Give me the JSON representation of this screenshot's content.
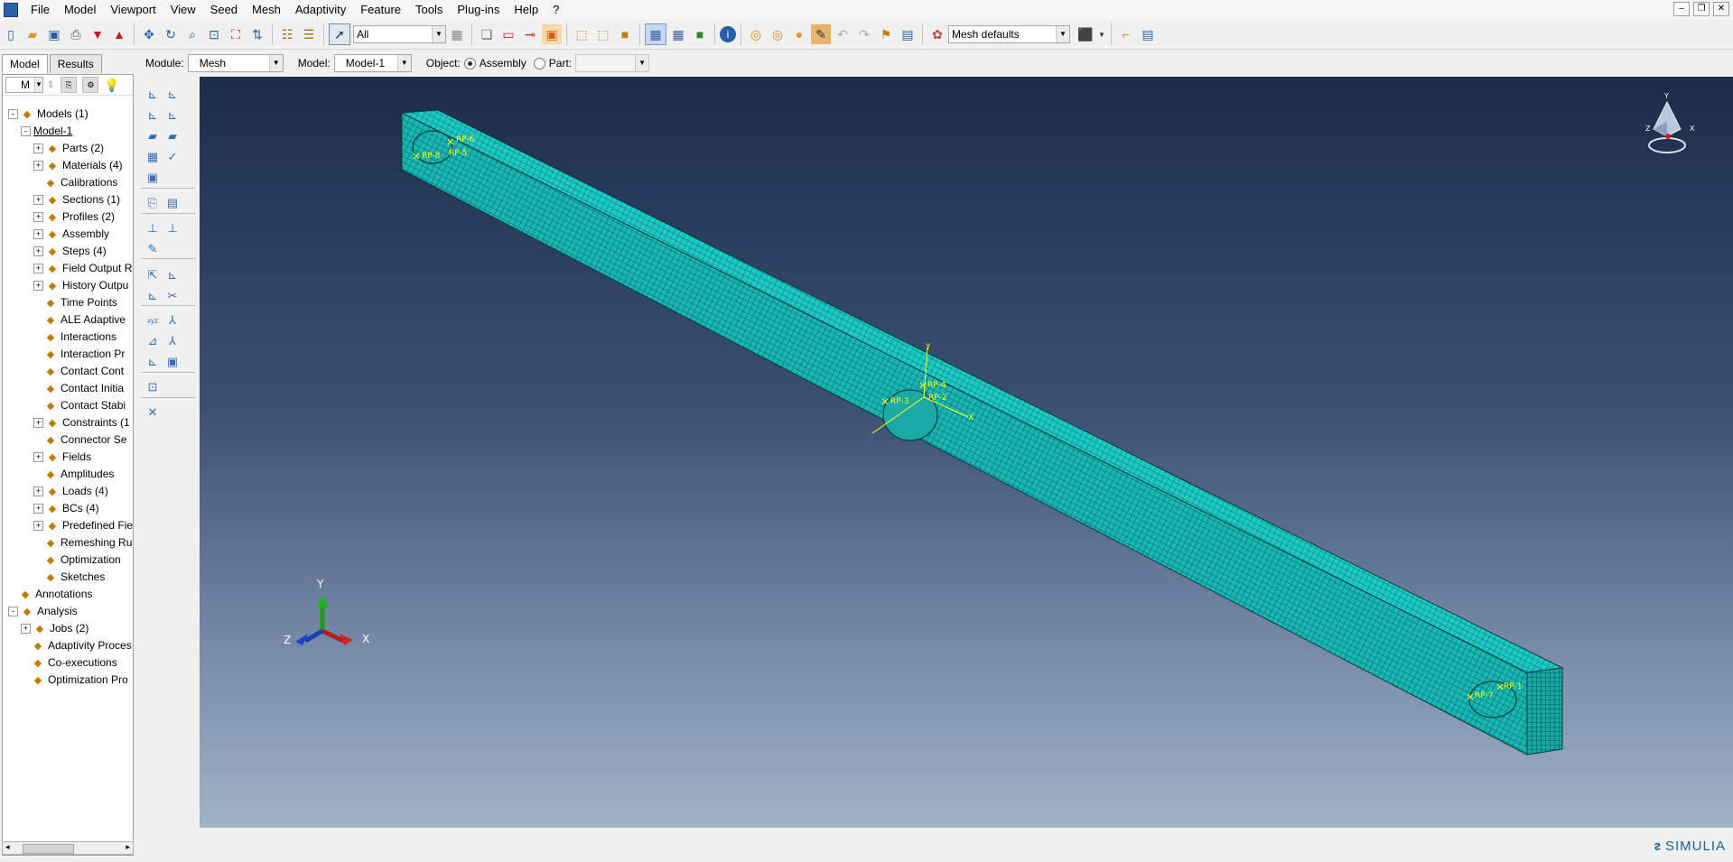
{
  "menu": [
    "File",
    "Model",
    "Viewport",
    "View",
    "Seed",
    "Mesh",
    "Adaptivity",
    "Feature",
    "Tools",
    "Plug-ins",
    "Help",
    "?"
  ],
  "toolbar": {
    "selection_filter": "All",
    "display_group_value": "Mesh defaults"
  },
  "context": {
    "module_label": "Module:",
    "module_value": "Mesh",
    "model_label": "Model:",
    "model_value": "Model-1",
    "object_label": "Object:",
    "assembly_label": "Assembly",
    "part_label": "Part:",
    "part_value": "",
    "object_selected": "Assembly"
  },
  "tabs": [
    "Model",
    "Results"
  ],
  "tree_tools_selector": "M",
  "tree": [
    {
      "label": "Models (1)",
      "level": 0,
      "exp": "-",
      "icon": "models-icon"
    },
    {
      "label": "Model-1",
      "level": 1,
      "exp": "-",
      "icon": ""
    },
    {
      "label": "Parts (2)",
      "level": 2,
      "exp": "+",
      "icon": "parts-icon"
    },
    {
      "label": "Materials (4)",
      "level": 2,
      "exp": "+",
      "icon": "materials-icon"
    },
    {
      "label": "Calibrations",
      "level": 2,
      "exp": "",
      "icon": "calibrations-icon"
    },
    {
      "label": "Sections (1)",
      "level": 2,
      "exp": "+",
      "icon": "sections-icon"
    },
    {
      "label": "Profiles (2)",
      "level": 2,
      "exp": "+",
      "icon": "profiles-icon"
    },
    {
      "label": "Assembly",
      "level": 2,
      "exp": "+",
      "icon": "assembly-icon"
    },
    {
      "label": "Steps (4)",
      "level": 2,
      "exp": "+",
      "icon": "steps-icon"
    },
    {
      "label": "Field Output R",
      "level": 2,
      "exp": "+",
      "icon": "field-output-icon"
    },
    {
      "label": "History Outpu",
      "level": 2,
      "exp": "+",
      "icon": "history-output-icon"
    },
    {
      "label": "Time Points",
      "level": 2,
      "exp": "",
      "icon": "time-points-icon"
    },
    {
      "label": "ALE Adaptive",
      "level": 2,
      "exp": "",
      "icon": "ale-icon"
    },
    {
      "label": "Interactions",
      "level": 2,
      "exp": "",
      "icon": "interactions-icon"
    },
    {
      "label": "Interaction Pr",
      "level": 2,
      "exp": "",
      "icon": "interaction-props-icon"
    },
    {
      "label": "Contact Cont",
      "level": 2,
      "exp": "",
      "icon": "contact-controls-icon"
    },
    {
      "label": "Contact Initia",
      "level": 2,
      "exp": "",
      "icon": "contact-init-icon"
    },
    {
      "label": "Contact Stabi",
      "level": 2,
      "exp": "",
      "icon": "contact-stab-icon"
    },
    {
      "label": "Constraints (1",
      "level": 2,
      "exp": "+",
      "icon": "constraints-icon"
    },
    {
      "label": "Connector Se",
      "level": 2,
      "exp": "",
      "icon": "connector-icon"
    },
    {
      "label": "Fields",
      "level": 2,
      "exp": "+",
      "icon": "fields-icon"
    },
    {
      "label": "Amplitudes",
      "level": 2,
      "exp": "",
      "icon": "amplitudes-icon"
    },
    {
      "label": "Loads (4)",
      "level": 2,
      "exp": "+",
      "icon": "loads-icon"
    },
    {
      "label": "BCs (4)",
      "level": 2,
      "exp": "+",
      "icon": "bcs-icon"
    },
    {
      "label": "Predefined Fie",
      "level": 2,
      "exp": "+",
      "icon": "predefined-icon"
    },
    {
      "label": "Remeshing Ru",
      "level": 2,
      "exp": "",
      "icon": "remeshing-icon"
    },
    {
      "label": "Optimization",
      "level": 2,
      "exp": "",
      "icon": "optimization-icon"
    },
    {
      "label": "Sketches",
      "level": 2,
      "exp": "",
      "icon": "sketches-icon"
    },
    {
      "label": "Annotations",
      "level": 0,
      "exp": "",
      "icon": "annotations-icon"
    },
    {
      "label": "Analysis",
      "level": 0,
      "exp": "-",
      "icon": "analysis-icon"
    },
    {
      "label": "Jobs (2)",
      "level": 1,
      "exp": "+",
      "icon": "jobs-icon"
    },
    {
      "label": "Adaptivity Proces",
      "level": 1,
      "exp": "",
      "icon": "adaptivity-icon"
    },
    {
      "label": "Co-executions",
      "level": 1,
      "exp": "",
      "icon": "coexec-icon"
    },
    {
      "label": "Optimization Pro",
      "level": 1,
      "exp": "",
      "icon": "opt-process-icon"
    }
  ],
  "viewport": {
    "reference_points": [
      "RP-6",
      "RP-5",
      "RP-8",
      "RP-4",
      "RP-3",
      "RP-2",
      "RP-1",
      "RP-7"
    ],
    "triad": {
      "x": "X",
      "y": "Y",
      "z": "Z"
    },
    "view_cube": {
      "x": "X",
      "y": "Y",
      "z": "Z"
    },
    "mesh_color": "#19c7c3",
    "rp_color": "#ffff00"
  },
  "brand": "SIMULIA"
}
